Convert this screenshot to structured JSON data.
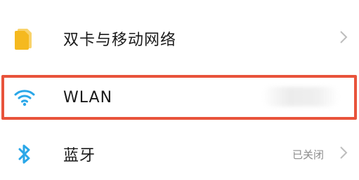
{
  "settings": {
    "items": [
      {
        "label": "双卡与移动网络",
        "icon": "sim-cards-icon",
        "status": ""
      },
      {
        "label": "WLAN",
        "icon": "wifi-icon",
        "status": ""
      },
      {
        "label": "蓝牙",
        "icon": "bluetooth-icon",
        "status": "已关闭"
      }
    ]
  },
  "colors": {
    "highlight": "#e8533b",
    "wifi": "#2aa7e8",
    "bluetooth": "#2aa7e8",
    "sim": "#f5b91f"
  }
}
